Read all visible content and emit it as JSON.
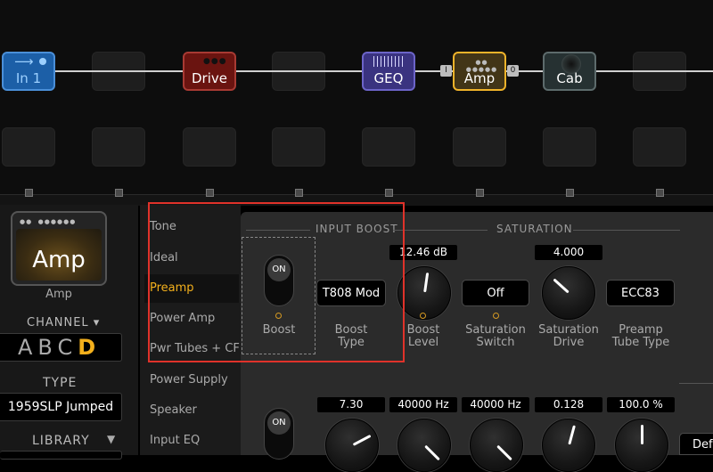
{
  "grid": {
    "blocks": {
      "in": "In 1",
      "drive": "Drive",
      "geq": "GEQ",
      "amp": "Amp",
      "cab": "Cab"
    },
    "tag_left": "I",
    "tag_right": "0"
  },
  "amp_panel": {
    "tile_label": "Amp",
    "caption": "Amp",
    "channel_header": "CHANNEL ▾",
    "channels": [
      "A",
      "B",
      "C",
      "D"
    ],
    "active_channel": "D",
    "type_header": "TYPE",
    "type_value": "1959SLP Jumped",
    "library_header": "LIBRARY"
  },
  "categories": [
    "Tone",
    "Ideal",
    "Preamp",
    "Power Amp",
    "Pwr Tubes + CF",
    "Power Supply",
    "Speaker",
    "Input EQ"
  ],
  "params": {
    "input_boost_title": "INPUT BOOST",
    "saturation_title": "SATURATION",
    "boost_toggle": "ON",
    "boost_label": "Boost",
    "boost_type_value": "T808 Mod",
    "boost_type_label": "Boost Type",
    "boost_level_value": "12.46 dB",
    "boost_level_label": "Boost Level",
    "sat_switch_value": "Off",
    "sat_switch_label": "Saturation Switch",
    "sat_drive_value": "4.000",
    "sat_drive_label": "Saturation Drive",
    "preamp_tube_value": "ECC83",
    "preamp_tube_label": "Preamp Tube Type",
    "row2_toggle": "ON",
    "row2_values": [
      "7.30",
      "40000 Hz",
      "40000 Hz",
      "0.128",
      "100.0 %"
    ],
    "default_button": "Defa"
  },
  "colors": {
    "accent": "#f3b01c",
    "highlight": "#e0322a"
  }
}
